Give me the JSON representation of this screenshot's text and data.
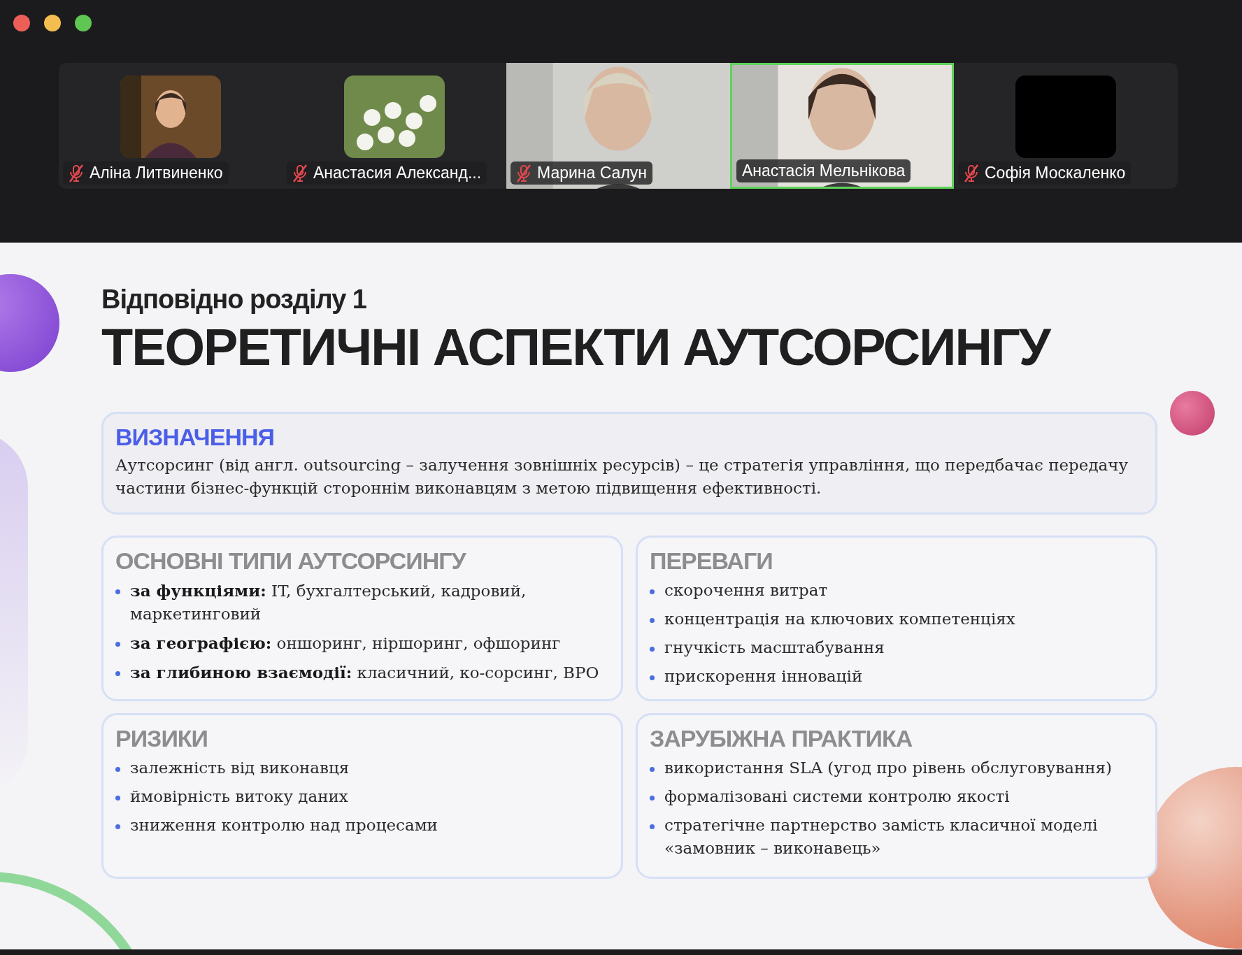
{
  "participants": [
    {
      "name": "Аліна Литвиненко",
      "muted": true,
      "kind": "avatar",
      "speaking": false
    },
    {
      "name": "Анастасия Александ...",
      "muted": true,
      "kind": "avatar",
      "speaking": false
    },
    {
      "name": "Марина Салун",
      "muted": true,
      "kind": "video",
      "speaking": false
    },
    {
      "name": "Анастасія Мельнікова",
      "muted": false,
      "kind": "video",
      "speaking": true
    },
    {
      "name": "Софія Москаленко",
      "muted": true,
      "kind": "blank",
      "speaking": false
    }
  ],
  "slide": {
    "subtitle": "Відповідно розділу 1",
    "title": "ТЕОРЕТИЧНІ АСПЕКТИ АУТСОРСИНГУ",
    "definition": {
      "heading": "ВИЗНАЧЕННЯ",
      "text": "Аутсорсинг (від англ. outsourcing – залучення зовнішніх ресурсів) – це стратегія управління, що передбачає передачу частини бізнес-функцій стороннім виконавцям з метою підвищення ефективності."
    },
    "cards": [
      {
        "heading": "ОСНОВНІ ТИПИ АУТСОРСИНГУ",
        "items": [
          "**за функціями:** IT, бухгалтерський, кадровий, маркетинговий",
          "**за географією:** оншоринг, ніршоринг, офшоринг",
          "**за глибиною взаємодії:** класичний, ко-сорсинг, BPO"
        ]
      },
      {
        "heading": "ПЕРЕВАГИ",
        "items": [
          "скорочення витрат",
          "концентрація на ключових компетенціях",
          "гнучкість масштабування",
          "прискорення інновацій"
        ]
      },
      {
        "heading": "РИЗИКИ",
        "items": [
          "залежність від виконавця",
          "ймовірність витоку даних",
          "зниження контролю над процесами"
        ]
      },
      {
        "heading": "ЗАРУБІЖНА ПРАКТИКА",
        "items": [
          "використання SLA (угод про рівень обслуговування)",
          "формалізовані системи контролю якості",
          "стратегічне партнерство замість класичної моделі «замовник – виконавець»"
        ]
      }
    ]
  }
}
